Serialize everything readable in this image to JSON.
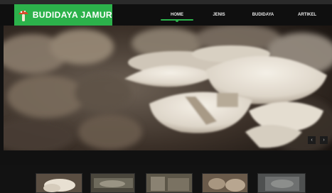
{
  "brand": {
    "name": "BUDIDAYA JAMUR",
    "color": "#2cb24b",
    "icon": "mushroom-icon"
  },
  "nav": {
    "items": [
      {
        "label": "HOME",
        "active": true
      },
      {
        "label": "JENIS",
        "active": false
      },
      {
        "label": "BUDIDAYA",
        "active": false
      },
      {
        "label": "ARTIKEL",
        "active": false
      }
    ]
  },
  "slider": {
    "prev_icon": "chevron-left-icon",
    "next_icon": "chevron-right-icon",
    "prev_glyph": "‹",
    "next_glyph": "›"
  },
  "thumbnails": [
    {
      "name": "thumbnail-1",
      "tone": "#8a7e6a"
    },
    {
      "name": "thumbnail-2",
      "tone": "#6a6658"
    },
    {
      "name": "thumbnail-3",
      "tone": "#7c7668"
    },
    {
      "name": "thumbnail-4",
      "tone": "#8c7a68"
    },
    {
      "name": "thumbnail-5",
      "tone": "#6e7070"
    }
  ]
}
